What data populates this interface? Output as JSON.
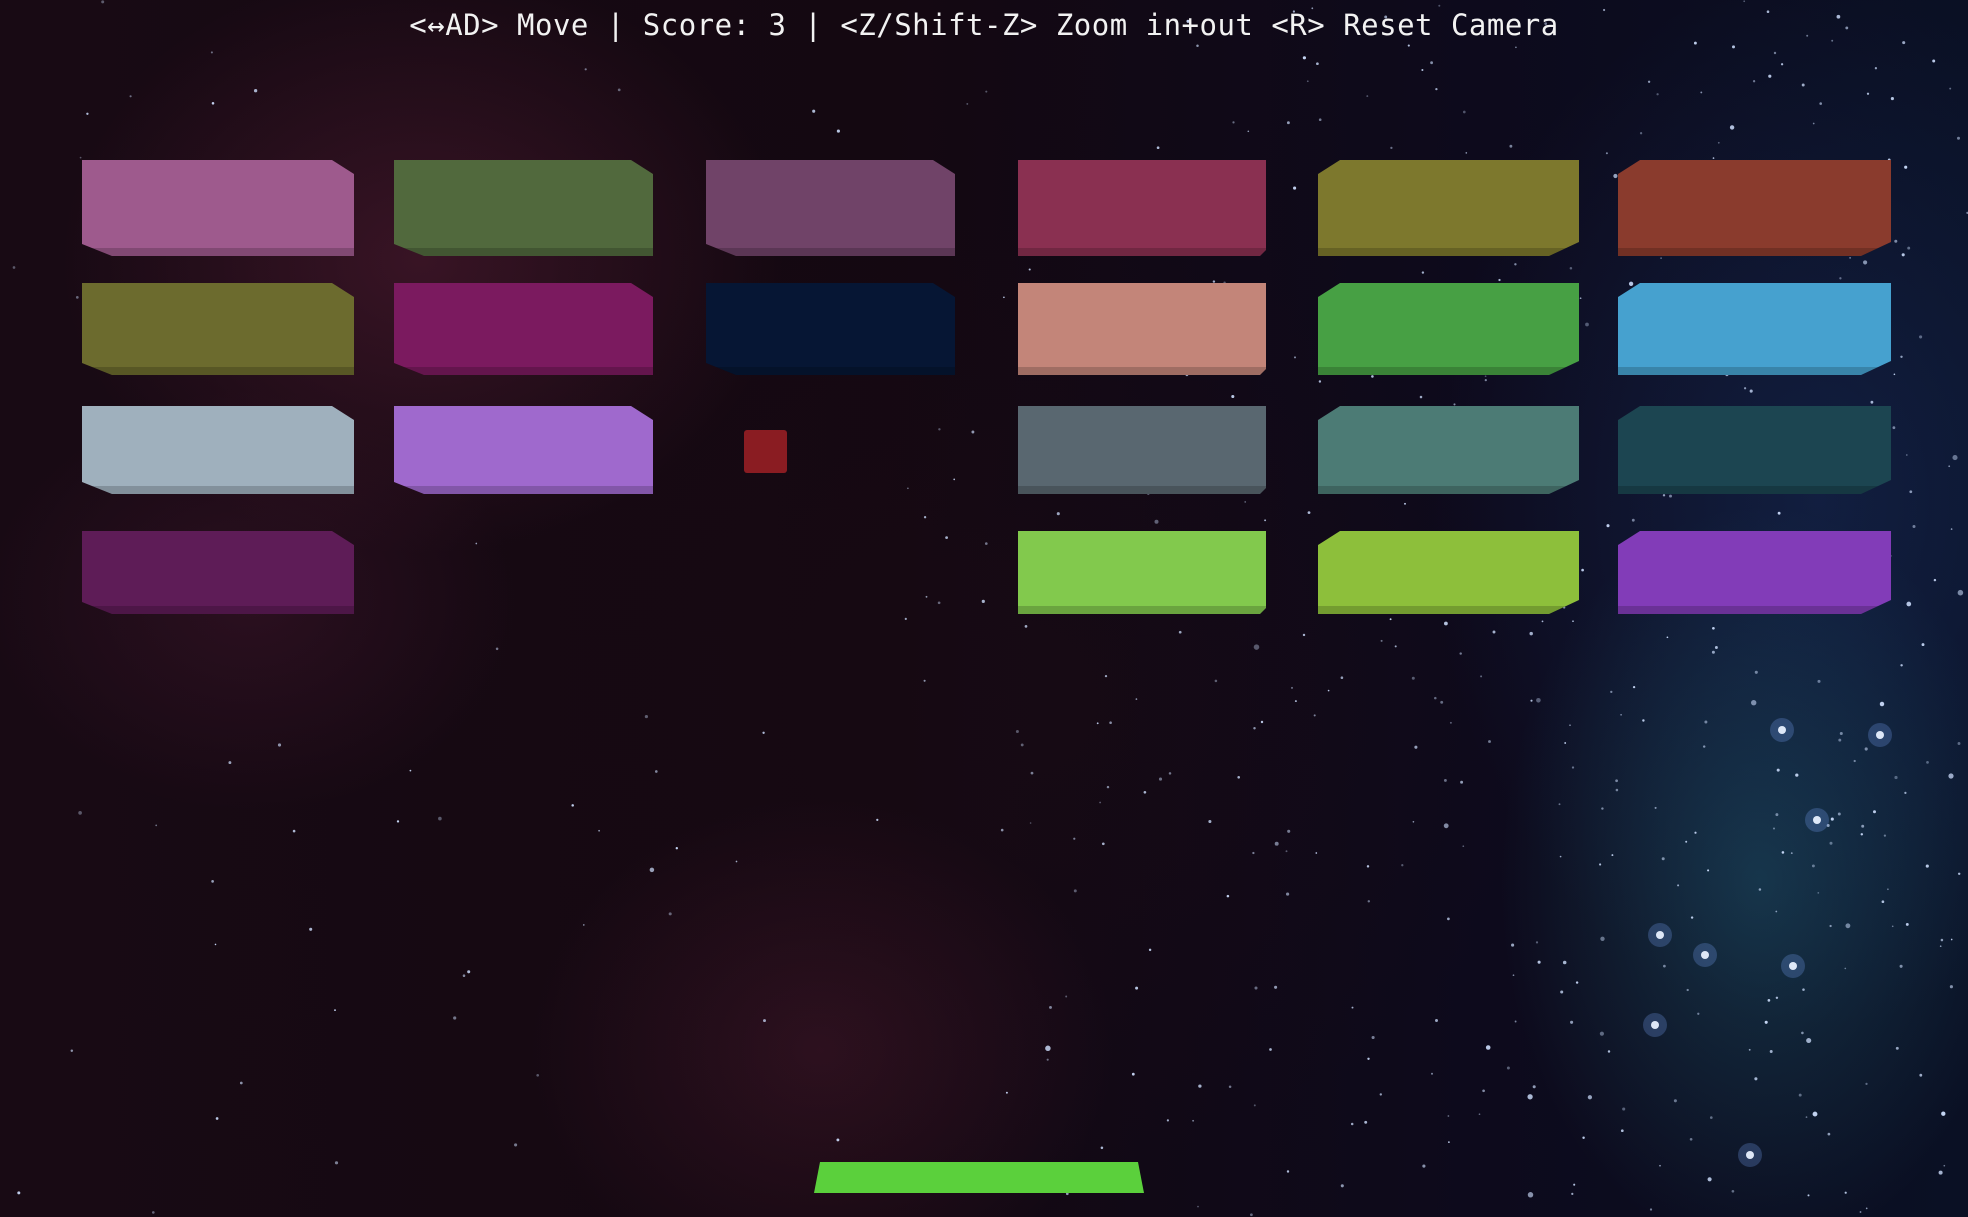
{
  "hud": {
    "text": "<↔AD> Move | Score: 3 | <Z/Shift-Z> Zoom in+out <R> Reset Camera"
  },
  "game": {
    "score": 3
  },
  "bricks": [
    {
      "row": 1,
      "col": 1,
      "color": "#9e5a8d"
    },
    {
      "row": 1,
      "col": 2,
      "color": "#51693d"
    },
    {
      "row": 1,
      "col": 3,
      "color": "#704368"
    },
    {
      "row": 1,
      "col": 4,
      "color": "#8a3051"
    },
    {
      "row": 1,
      "col": 5,
      "color": "#7d782d"
    },
    {
      "row": 1,
      "col": 6,
      "color": "#8a3b2d"
    },
    {
      "row": 2,
      "col": 1,
      "color": "#6c6b2e"
    },
    {
      "row": 2,
      "col": 2,
      "color": "#7b1a5f"
    },
    {
      "row": 2,
      "col": 3,
      "color": "#061634"
    },
    {
      "row": 2,
      "col": 4,
      "color": "#c38579"
    },
    {
      "row": 2,
      "col": 5,
      "color": "#47a044"
    },
    {
      "row": 2,
      "col": 6,
      "color": "#46a1cf"
    },
    {
      "row": 3,
      "col": 1,
      "color": "#9fb0bd"
    },
    {
      "row": 3,
      "col": 2,
      "color": "#9f69cd"
    },
    {
      "row": 3,
      "col": 4,
      "color": "#596770"
    },
    {
      "row": 3,
      "col": 5,
      "color": "#4c7b75"
    },
    {
      "row": 3,
      "col": 6,
      "color": "#1c4551"
    },
    {
      "row": 4,
      "col": 1,
      "color": "#5e1c57"
    },
    {
      "row": 4,
      "col": 4,
      "color": "#82c94d"
    },
    {
      "row": 4,
      "col": 5,
      "color": "#8dbf3b"
    },
    {
      "row": 4,
      "col": 6,
      "color": "#823cb8"
    }
  ],
  "ball": {
    "color": "#8a1c22"
  },
  "paddle": {
    "color": "#5bd03c"
  }
}
